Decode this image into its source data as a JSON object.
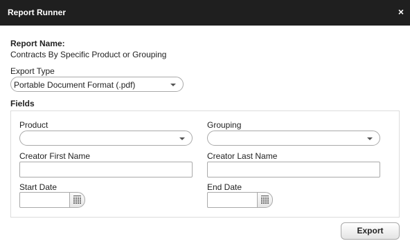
{
  "dialog": {
    "title": "Report Runner",
    "close_glyph": "×"
  },
  "report": {
    "name_label": "Report Name:",
    "name_value": "Contracts By Specific Product or Grouping"
  },
  "export_type": {
    "label": "Export Type",
    "selected": "Portable Document Format (.pdf)"
  },
  "fields": {
    "label": "Fields",
    "product": {
      "label": "Product",
      "selected": ""
    },
    "grouping": {
      "label": "Grouping",
      "selected": ""
    },
    "creator_first_name": {
      "label": "Creator First Name",
      "value": ""
    },
    "creator_last_name": {
      "label": "Creator Last Name",
      "value": ""
    },
    "start_date": {
      "label": "Start Date",
      "value": ""
    },
    "end_date": {
      "label": "End Date",
      "value": ""
    }
  },
  "actions": {
    "export_label": "Export"
  },
  "icons": {
    "close": "close-icon",
    "dropdown": "chevron-down-icon",
    "calendar": "calendar-icon"
  },
  "colors": {
    "titlebar_bg": "#1f1f1f",
    "titlebar_text": "#ffffff",
    "border": "#a9a9a9"
  }
}
